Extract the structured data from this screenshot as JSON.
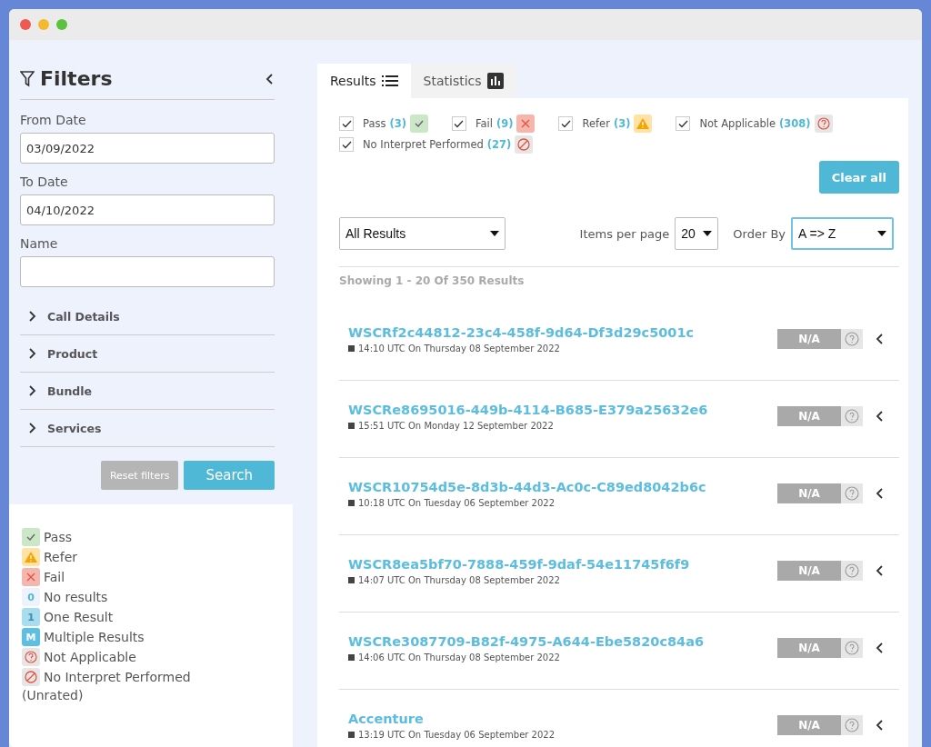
{
  "sidebar": {
    "title": "Filters",
    "fields": [
      {
        "label": "From Date",
        "value": "03/09/2022"
      },
      {
        "label": "To Date",
        "value": "04/10/2022"
      },
      {
        "label": "Name"
      }
    ],
    "sections": [
      {
        "label": "Call Details",
        "expanded": false
      },
      {
        "label": "Product",
        "expanded": false
      },
      {
        "label": "Bundle",
        "expanded": false
      },
      {
        "label": "Services",
        "expanded": false
      }
    ],
    "buttons": {
      "reset": "Reset filters",
      "search": "Search"
    },
    "legend": [
      {
        "kind": "pass",
        "label": "Pass"
      },
      {
        "kind": "refer",
        "label": "Refer"
      },
      {
        "kind": "fail",
        "label": "Fail"
      },
      {
        "kind": "zero",
        "glyph": "0",
        "label": "No results"
      },
      {
        "kind": "one",
        "glyph": "1",
        "label": "One Result"
      },
      {
        "kind": "multiple",
        "glyph": "M",
        "label": "Multiple Results"
      },
      {
        "kind": "not_applicable",
        "label": "Not Applicable"
      },
      {
        "kind": "no_interpret",
        "label": "No Interpret Performed"
      }
    ],
    "legend_note": "(Unrated)"
  },
  "tabs": [
    {
      "label": "Results",
      "kind": "list",
      "selected": true
    },
    {
      "label": "Statistics",
      "kind": "chart",
      "selected": false
    }
  ],
  "status_filters": [
    {
      "label": "Pass",
      "count": "(3)",
      "kind": "pass",
      "checked": true
    },
    {
      "label": "Fail",
      "count": "(9)",
      "kind": "fail",
      "checked": true
    },
    {
      "label": "Refer",
      "count": "(3)",
      "kind": "refer",
      "checked": true
    },
    {
      "label": "Not Applicable",
      "count": "(308)",
      "kind": "not_applicable",
      "checked": true
    },
    {
      "label": "No Interpret Performed",
      "count": "(27)",
      "kind": "no_interpret",
      "checked": true
    }
  ],
  "clear_button": "Clear all",
  "result_filter": "All Results",
  "items_per_page": {
    "label": "Items per page",
    "value": "20"
  },
  "order_by": {
    "label": "Order By",
    "value": "A => Z"
  },
  "summary": "Showing 1 - 20 Of 350 Results",
  "results": [
    {
      "name": "WSCRf2c44812-23c4-458f-9d64-Df3d29c5001c",
      "time": "14:10 UTC On Thursday 08 September 2022",
      "status": "N/A",
      "kind": "not_applicable"
    },
    {
      "name": "WSCRe8695016-449b-4114-B685-E379a25632e6",
      "time": "15:51 UTC On Monday 12 September 2022",
      "status": "N/A",
      "kind": "not_applicable"
    },
    {
      "name": "WSCR10754d5e-8d3b-44d3-Ac0c-C89ed8042b6c",
      "time": "10:18 UTC On Tuesday 06 September 2022",
      "status": "N/A",
      "kind": "not_applicable"
    },
    {
      "name": "WSCR8ea5bf70-7888-459f-9daf-54e11745f6f9",
      "time": "14:07 UTC On Thursday 08 September 2022",
      "status": "N/A",
      "kind": "not_applicable"
    },
    {
      "name": "WSCRe3087709-B82f-4975-A644-Ebe5820c84a6",
      "time": "14:06 UTC On Thursday 08 September 2022",
      "status": "N/A",
      "kind": "not_applicable"
    },
    {
      "name": "Accenture",
      "time": "13:19 UTC On Tuesday 06 September 2022",
      "status": "N/A",
      "kind": "not_applicable"
    }
  ]
}
